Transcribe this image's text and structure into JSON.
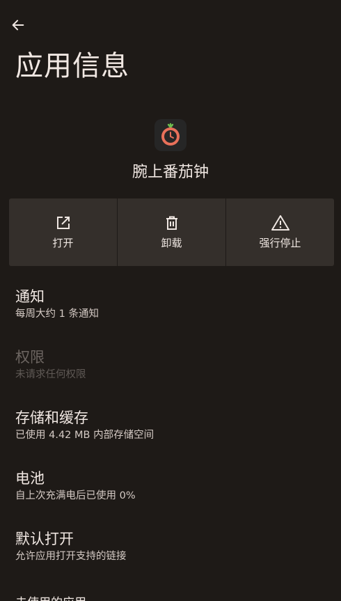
{
  "header": {
    "title": "应用信息"
  },
  "app": {
    "name": "腕上番茄钟",
    "icon": "tomato-clock-icon",
    "icon_color": "#e8705a",
    "leaf_color": "#6dbb4e"
  },
  "actions": [
    {
      "label": "打开",
      "icon": "open-external-icon"
    },
    {
      "label": "卸载",
      "icon": "trash-icon"
    },
    {
      "label": "强行停止",
      "icon": "warning-icon"
    }
  ],
  "settings": [
    {
      "title": "通知",
      "summary": "每周大约 1 条通知",
      "enabled": true
    },
    {
      "title": "权限",
      "summary": "未请求任何权限",
      "enabled": false
    },
    {
      "title": "存储和缓存",
      "summary": "已使用 4.42 MB 内部存储空间",
      "enabled": true
    },
    {
      "title": "电池",
      "summary": "自上次充满电后已使用 0%",
      "enabled": true
    },
    {
      "title": "默认打开",
      "summary": "允许应用打开支持的链接",
      "enabled": true
    }
  ],
  "partial_item": {
    "title": "未使用的应用"
  },
  "colors": {
    "background": "#1e1a17",
    "button_bg": "#342f2b",
    "text": "#f1e8e3",
    "disabled_text": "#6c6561"
  }
}
